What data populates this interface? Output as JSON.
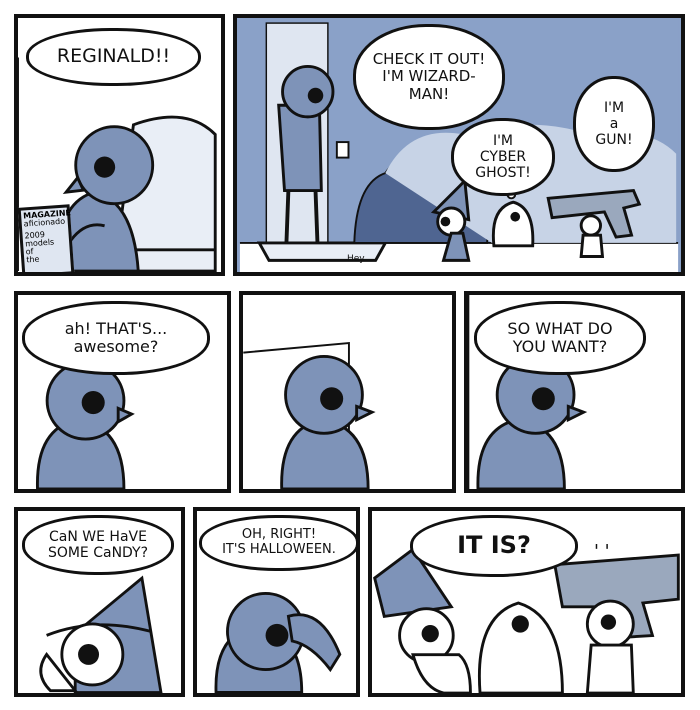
{
  "colors": {
    "ink": "#111111",
    "body": "#7e93b8",
    "shade": "#4f6591",
    "bg_blue": "#8aa1c8",
    "paper": "#ffffff"
  },
  "panel1": {
    "speech": "REGINALD!!",
    "magazine": {
      "title": "MAGAZINE",
      "subtitle": "aficionado",
      "issue": "2009",
      "extra1": "models",
      "extra2": "of",
      "extra3": "the"
    }
  },
  "panel2": {
    "speech_wizard": "CHECK IT OUT!\nI'M WIZARD-\nMAN!",
    "speech_ghost": "I'M\nCYBER\nGHOST!",
    "speech_gun": "I'M\na\nGUN!",
    "doormat": "Hey"
  },
  "panel3": {
    "speech": "ah! THAT'S...\nawesome?"
  },
  "panel5": {
    "speech": "SO WHAT DO\nYOU WANT?"
  },
  "panel6": {
    "speech": "CaN WE HaVE\nSOME CaNDY?"
  },
  "panel7": {
    "speech": "OH, RIGHT!\nIT'S HALLOWEEN."
  },
  "panel8": {
    "speech": "IT IS?",
    "marks": "' '"
  }
}
